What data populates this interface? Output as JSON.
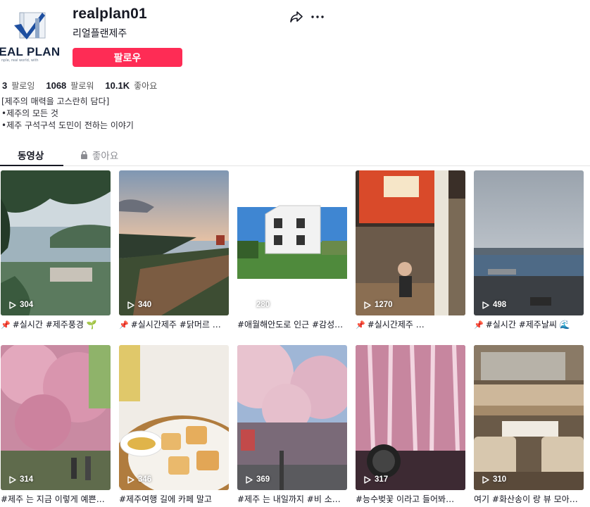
{
  "profile": {
    "username": "realplan01",
    "nickname": "리얼플랜제주",
    "avatar_text": "'EAL PLAN",
    "avatar_tagline": "nple, real world, with",
    "follow_label": "팔로우",
    "share_icon": "share-icon",
    "more_icon": "more-icon"
  },
  "stats": {
    "following_count": "3",
    "following_label": "팔로잉",
    "followers_count": "1068",
    "followers_label": "팔로워",
    "likes_count": "10.1K",
    "likes_label": "좋아요"
  },
  "bio": [
    "[제주의 매력을 고스란히 담다]",
    "•제주의 모든 것",
    "•제주 구석구석 도민이 전하는 이야기"
  ],
  "tabs": {
    "videos": "동영상",
    "liked": "좋아요"
  },
  "videos": [
    {
      "views": "304",
      "caption": "#실시간 #제주풍경 🌱",
      "pinned": true
    },
    {
      "views": "340",
      "caption": "#실시간제주 #닭머르 …",
      "pinned": true
    },
    {
      "views": "280",
      "caption": "#애월해안도로 인근 #감성…",
      "pinned": false
    },
    {
      "views": "1270",
      "caption": "#실시간제주 …",
      "pinned": true
    },
    {
      "views": "498",
      "caption": "#실시간 #제주날씨 🌊",
      "pinned": true
    },
    {
      "views": "314",
      "caption": "#제주 는 지금 이렇게 예쁜…",
      "pinned": false
    },
    {
      "views": "346",
      "caption": "#제주여행 길에 카페 말고",
      "pinned": false
    },
    {
      "views": "369",
      "caption": "#제주 는 내일까지 #비 소…",
      "pinned": false
    },
    {
      "views": "317",
      "caption": "#능수벚꽃 이라고 들어봐…",
      "pinned": false
    },
    {
      "views": "310",
      "caption": "여기 #화산송이 랑 뷰 모아…",
      "pinned": false
    }
  ],
  "colors": {
    "accent": "#fe2c55",
    "text": "#161823",
    "muted": "#8a8b91"
  }
}
